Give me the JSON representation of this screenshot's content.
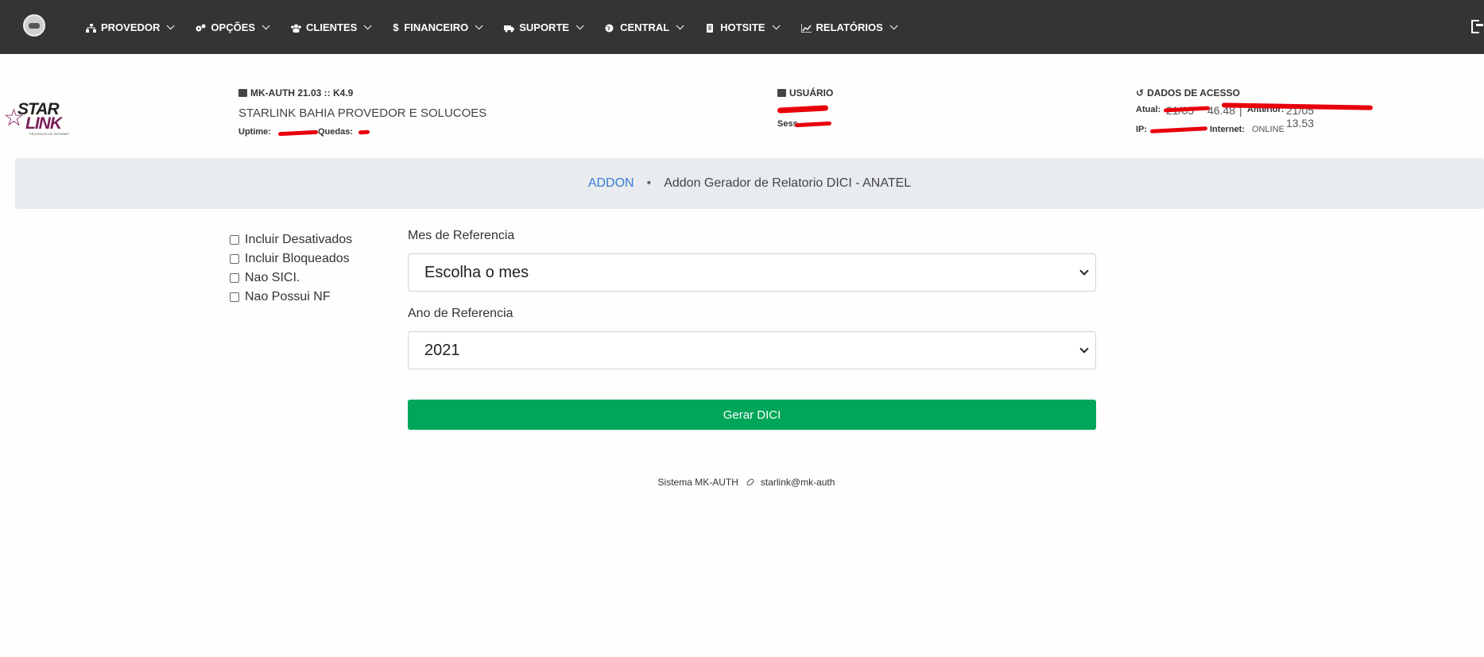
{
  "nav": {
    "items": [
      {
        "label": "PROVEDOR",
        "icon": "sitemap-icon"
      },
      {
        "label": "OPÇÕES",
        "icon": "cogs-icon"
      },
      {
        "label": "CLIENTES",
        "icon": "users-icon"
      },
      {
        "label": "FINANCEIRO",
        "icon": "dollar-icon"
      },
      {
        "label": "SUPORTE",
        "icon": "ambulance-icon"
      },
      {
        "label": "CENTRAL",
        "icon": "globe-icon"
      },
      {
        "label": "HOTSITE",
        "icon": "page-icon"
      },
      {
        "label": "RELATÓRIOS",
        "icon": "chart-icon"
      }
    ]
  },
  "brand": {
    "star": "STAR",
    "link": "LINK",
    "tagline": "PROVEDOR DE INTERNET"
  },
  "system": {
    "version": "MK-AUTH 21.03 :: K4.9",
    "company": "STARLINK BAHIA PROVEDOR E SOLUCOES",
    "uptime_label": "Uptime:",
    "quedas_label": "Quedas:"
  },
  "user": {
    "heading": "USUÁRIO",
    "session_label": "Sess"
  },
  "access": {
    "heading": "DADOS DE ACESSO",
    "atual_label": "Atual:",
    "atual_value": "21/05",
    "atual_time": "46.48",
    "anterior_label": "Anterior:",
    "anterior_value": "21/05 13.53",
    "ip_label": "IP:",
    "internet_label": "Internet:",
    "internet_value": "ONLINE"
  },
  "breadcrumb": {
    "link": "ADDON",
    "separator": "•",
    "current": "Addon Gerador de Relatorio DICI - ANATEL"
  },
  "options": [
    "Incluir Desativados",
    "Incluir Bloqueados",
    "Nao SICI.",
    "Nao Possui NF"
  ],
  "form": {
    "month_label": "Mes de Referencia",
    "month_value": "Escolha o mes",
    "year_label": "Ano de Referencia",
    "year_value": "2021",
    "submit": "Gerar DICI"
  },
  "footer": {
    "system": "Sistema MK-AUTH",
    "user": "starlink@mk-auth"
  }
}
